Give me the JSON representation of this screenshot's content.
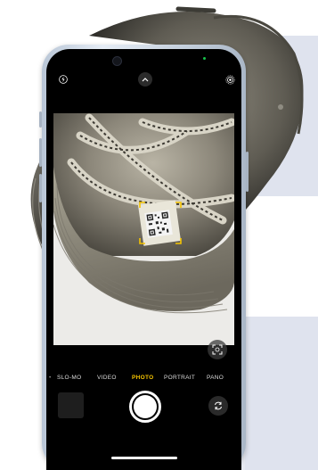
{
  "camera": {
    "modes": [
      {
        "label": "SLO-MO",
        "active": false
      },
      {
        "label": "VIDEO",
        "active": false
      },
      {
        "label": "PHOTO",
        "active": true
      },
      {
        "label": "PORTRAIT",
        "active": false
      },
      {
        "label": "PANO",
        "active": false
      }
    ],
    "icons": {
      "flash": "flash-icon",
      "chevron": "chevron-up-icon",
      "live_photo": "live-photo-icon",
      "lens": "lens-toggle-icon",
      "flip": "flip-camera-icon"
    }
  },
  "colors": {
    "active_mode": "#f7c500",
    "qr_frame": "#f5c400",
    "phone_frame": "#c4cfdc",
    "panel": "#dfe3ee"
  }
}
